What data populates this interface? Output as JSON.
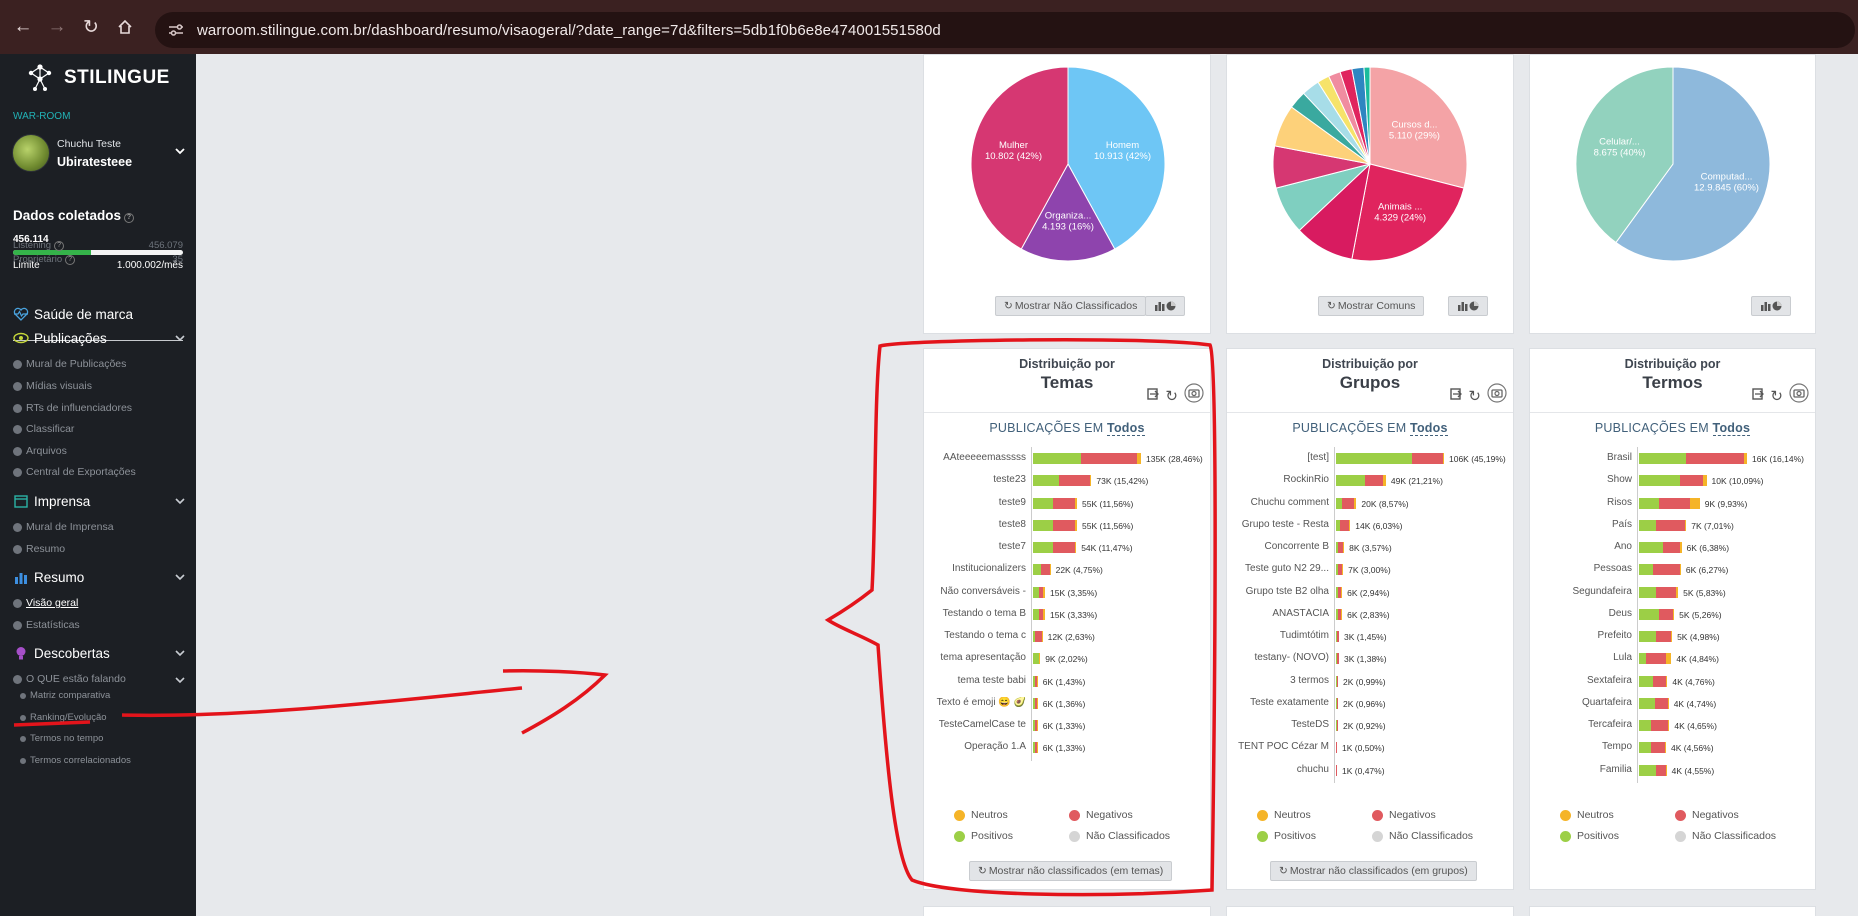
{
  "browser": {
    "url": "warroom.stilingue.com.br/dashboard/resumo/visaogeral/?date_range=7d&filters=5db1f0b6e8e474001551580d"
  },
  "sidebar": {
    "brand": "STILINGUE",
    "section_label": "WAR-ROOM",
    "user_name": "Chuchu Teste",
    "user_login": "Ubiratesteee",
    "data_title": "Dados coletados",
    "data_count": "456.114",
    "usage_fraction": 0.456,
    "limit_label": "Limite",
    "limit_value": "1.000.002/mês",
    "listening_label": "Listening",
    "listening_value": "456.079",
    "owner_label": "Proprietário",
    "owner_value": "35",
    "menu": {
      "saude": "Saúde de marca",
      "publicacoes": "Publicações",
      "publicacoes_items": [
        "Mural de Publicações",
        "Mídias visuais",
        "RTs de influenciadores",
        "Classificar",
        "Arquivos",
        "Central de Exportações"
      ],
      "imprensa": "Imprensa",
      "imprensa_items": [
        "Mural de Imprensa",
        "Resumo"
      ],
      "resumo": "Resumo",
      "resumo_items": [
        "Visão geral",
        "Estatísticas"
      ],
      "descobertas": "Descobertas",
      "descobertas_item": "O QUE estão falando",
      "descobertas_subitems": [
        "Matriz comparativa",
        "Ranking/Evolução",
        "Termos no tempo",
        "Termos correlacionados"
      ]
    }
  },
  "pies": {
    "genero": {
      "button": "Mostrar Não Classificados",
      "slices": [
        {
          "label": "Homem",
          "value": "10.913 (42%)",
          "pct": 42,
          "color": "#6ec6f5"
        },
        {
          "label": "Organiza...",
          "value": "4.193 (16%)",
          "pct": 16,
          "color": "#8e44ad"
        },
        {
          "label": "Mulher",
          "value": "10.802 (42%)",
          "pct": 42,
          "color": "#d63772"
        }
      ]
    },
    "interesses": {
      "button": "Mostrar Comuns",
      "slices": [
        {
          "label": "Cursos d...",
          "value": "5.110 (29%)",
          "pct": 29,
          "color": "#f4a3a6"
        },
        {
          "label": "Animais ...",
          "value": "4.329 (24%)",
          "pct": 24,
          "color": "#e0245e"
        },
        {
          "label": "",
          "value": "",
          "pct": 10,
          "color": "#d81b60"
        },
        {
          "label": "",
          "value": "",
          "pct": 8,
          "color": "#7fcfc0"
        },
        {
          "label": "",
          "value": "",
          "pct": 7,
          "color": "#d63772"
        },
        {
          "label": "",
          "value": "",
          "pct": 7,
          "color": "#fdd17a"
        },
        {
          "label": "",
          "value": "",
          "pct": 3,
          "color": "#3aa99f"
        },
        {
          "label": "",
          "value": "",
          "pct": 3,
          "color": "#a7dde8"
        },
        {
          "label": "",
          "value": "",
          "pct": 2,
          "color": "#f6e36a"
        },
        {
          "label": "",
          "value": "",
          "pct": 2,
          "color": "#f08ca0"
        },
        {
          "label": "",
          "value": "",
          "pct": 2,
          "color": "#e0245e"
        },
        {
          "label": "",
          "value": "",
          "pct": 2,
          "color": "#2e86c1"
        },
        {
          "label": "",
          "value": "",
          "pct": 1,
          "color": "#1abc9c"
        }
      ]
    },
    "dispositivos": {
      "slices": [
        {
          "label": "Computad...",
          "value": "12.9.845 (60%)",
          "pct": 60,
          "color": "#8eb9dc"
        },
        {
          "label": "Celular/...",
          "value": "8.675 (40%)",
          "pct": 40,
          "color": "#92d2be"
        }
      ]
    }
  },
  "distribution": {
    "title_prefix": "Distribuição por",
    "pub_prefix": "PUBLICAÇÕES EM",
    "pub_link": "Todos",
    "legend": {
      "neutros": "Neutros",
      "negativos": "Negativos",
      "positivos": "Positivos",
      "nao_classificados": "Não Classificados"
    },
    "colors": {
      "positivo": "#9ccf46",
      "negativo": "#e05a5f",
      "neutro": "#f5b428"
    }
  },
  "chart_data": [
    {
      "type": "bar",
      "title": "Temas",
      "button": "Mostrar não classificados (em temas)",
      "categories": [
        "AAteeeeemasssss",
        "teste23",
        "teste9",
        "teste8",
        "teste7",
        "Institucionalizers",
        "Não conversáveis - ",
        "Testando o tema B",
        "Testando o tema c",
        "tema apresentação",
        "tema teste babi",
        "Texto é emoji 😄 🥑",
        "TesteCamelCase te",
        "Operação 1.A"
      ],
      "value_labels": [
        "135K (28,46%)",
        "73K (15,42%)",
        "55K (11,56%)",
        "55K (11,56%)",
        "54K (11,47%)",
        "22K (4,75%)",
        "15K (3,35%)",
        "15K (3,33%)",
        "12K (2,63%)",
        "9K (2,02%)",
        "6K (1,43%)",
        "6K (1,36%)",
        "6K (1,33%)",
        "6K (1,33%)"
      ],
      "series": [
        {
          "name": "Positivos",
          "values": [
            60,
            33,
            25,
            25,
            25,
            10,
            7,
            7,
            3,
            8,
            3,
            2,
            2,
            2
          ]
        },
        {
          "name": "Negativos",
          "values": [
            70,
            38,
            28,
            28,
            27,
            11,
            6,
            6,
            8,
            0,
            2,
            3,
            3,
            3
          ]
        },
        {
          "name": "Neutros",
          "values": [
            5,
            2,
            2,
            2,
            2,
            1,
            2,
            2,
            1,
            1,
            1,
            1,
            1,
            1
          ]
        }
      ]
    },
    {
      "type": "bar",
      "title": "Grupos",
      "button": "Mostrar não classificados (em grupos)",
      "categories": [
        "[test]",
        "RockinRio",
        "Chuchu comment",
        "Grupo teste - Resta",
        "Concorrente B",
        "Teste guto N2 29...",
        "Grupo tste B2 olha",
        "ANASTÁCIA",
        "Tudimtótim",
        "testany- (NOVO)",
        "3 termos",
        "Teste exatamente",
        "TesteDS",
        "TENT POC Cézar M",
        "chuchu"
      ],
      "value_labels": [
        "106K (45,19%)",
        "49K (21,21%)",
        "20K (8,57%)",
        "14K (6,03%)",
        "8K (3,57%)",
        "7K (3,00%)",
        "6K (2,94%)",
        "6K (2,83%)",
        "3K (1,45%)",
        "3K (1,38%)",
        "2K (0,99%)",
        "2K (0,96%)",
        "2K (0,92%)",
        "1K (0,50%)",
        "1K (0,47%)"
      ],
      "series": [
        {
          "name": "Positivos",
          "values": [
            75,
            28,
            6,
            4,
            2,
            2,
            2,
            2,
            1,
            1,
            1,
            1,
            1,
            0,
            0
          ]
        },
        {
          "name": "Negativos",
          "values": [
            30,
            18,
            12,
            9,
            5,
            4,
            3,
            3,
            2,
            2,
            1,
            1,
            1,
            1,
            1
          ]
        },
        {
          "name": "Neutros",
          "values": [
            1,
            3,
            2,
            1,
            1,
            1,
            1,
            1,
            0,
            0,
            0,
            0,
            0,
            0,
            0
          ]
        }
      ]
    },
    {
      "type": "bar",
      "title": "Termos",
      "button": "",
      "categories": [
        "Brasil",
        "Show",
        "Risos",
        "País",
        "Ano",
        "Pessoas",
        "Segundafeira",
        "Deus",
        "Prefeito",
        "Lula",
        "Sextafeira",
        "Quartafeira",
        "Tercafeira",
        "Tempo",
        "Familia"
      ],
      "value_labels": [
        "16K (16,14%)",
        "10K (10,09%)",
        "9K (9,93%)",
        "7K (7,01%)",
        "6K (6,38%)",
        "6K (6,27%)",
        "5K (5,83%)",
        "5K (5,26%)",
        "5K (4,98%)",
        "4K (4,84%)",
        "4K (4,76%)",
        "4K (4,74%)",
        "4K (4,65%)",
        "4K (4,56%)",
        "4K (4,55%)"
      ],
      "series": [
        {
          "name": "Positivos",
          "values": [
            7.0,
            6.0,
            3.0,
            2.5,
            3.5,
            2.0,
            2.5,
            3.0,
            2.5,
            1.0,
            2.0,
            2.3,
            1.8,
            1.8,
            2.5
          ]
        },
        {
          "name": "Negativos",
          "values": [
            8.5,
            3.5,
            4.5,
            4.3,
            2.5,
            4.0,
            3.0,
            2.0,
            2.3,
            3.0,
            2.0,
            2.0,
            2.5,
            2.0,
            1.5
          ]
        },
        {
          "name": "Neutros",
          "values": [
            0.5,
            0.5,
            1.5,
            0.2,
            0.3,
            0.2,
            0.3,
            0.2,
            0.1,
            0.8,
            0.2,
            0.1,
            0.2,
            0.2,
            0.1
          ]
        }
      ]
    }
  ]
}
